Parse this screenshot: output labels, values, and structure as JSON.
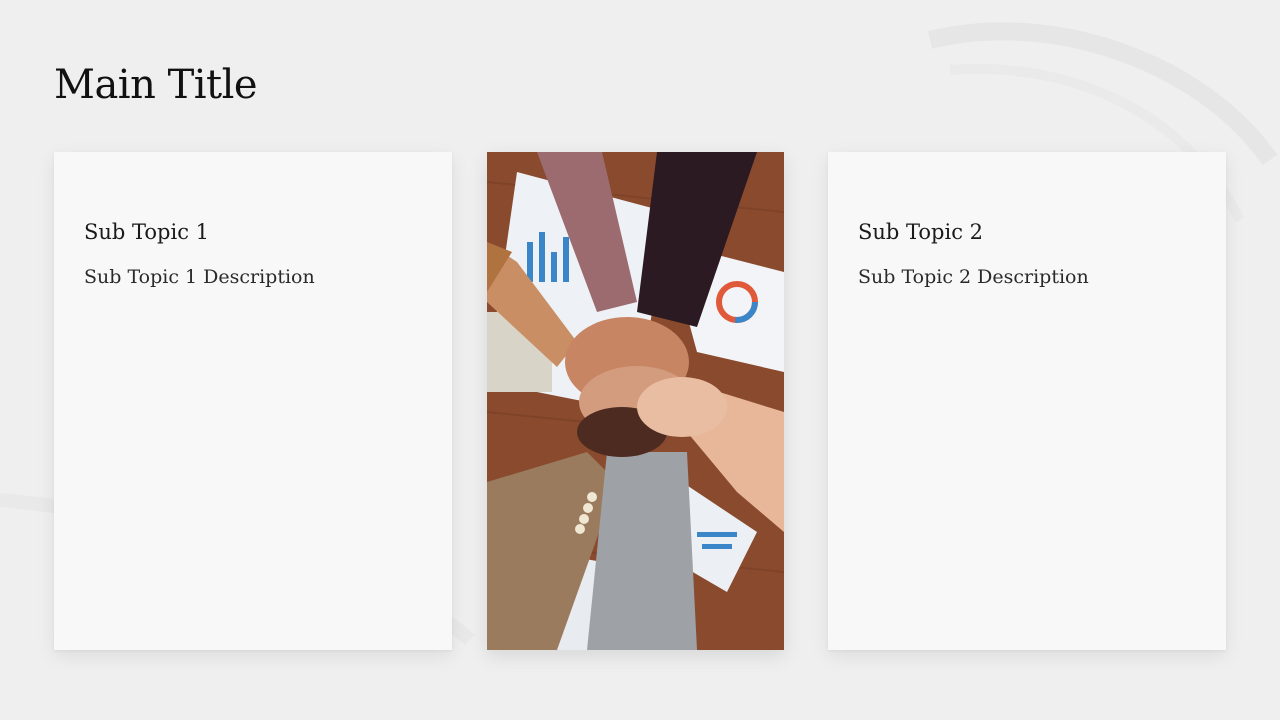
{
  "slide": {
    "title": "Main Title"
  },
  "cards": [
    {
      "title": "Sub Topic 1",
      "description": "Sub Topic 1 Description"
    },
    {
      "title": "Sub Topic 2",
      "description": "Sub Topic 2 Description"
    }
  ],
  "photo": {
    "subject": "team-hands-stacked-photo"
  },
  "colors": {
    "background": "#efefef",
    "card": "#f8f8f8",
    "title": "#111111"
  }
}
